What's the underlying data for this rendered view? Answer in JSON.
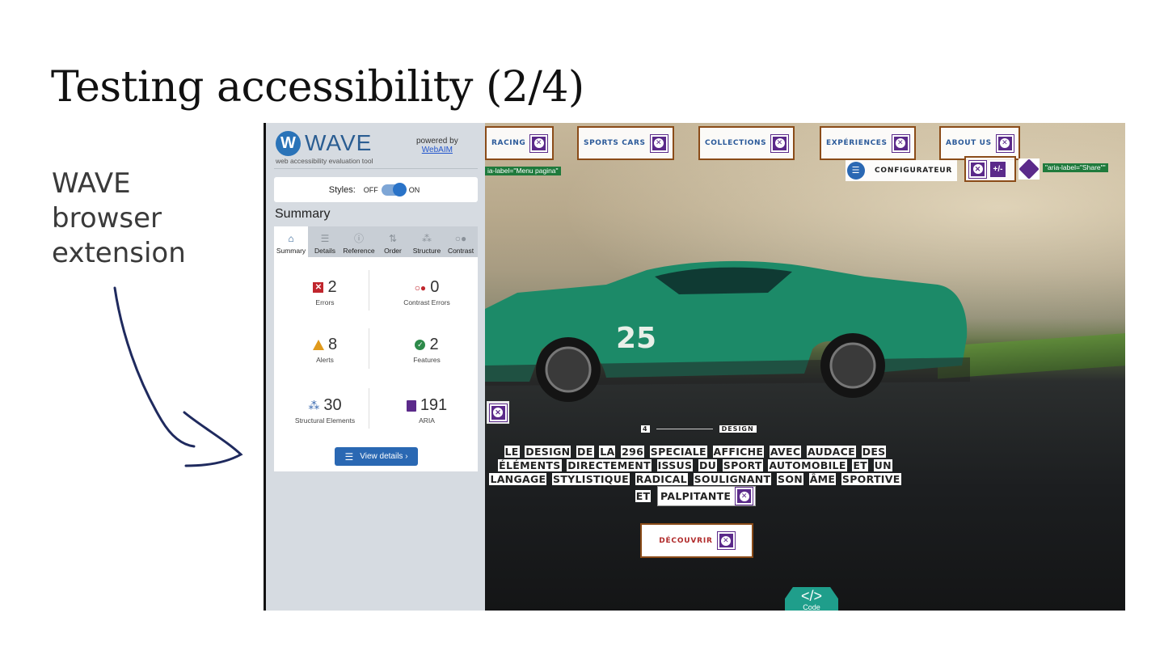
{
  "slide": {
    "title": "Testing accessibility (2/4)",
    "side_label": "WAVE browser extension"
  },
  "wave": {
    "logo_text": "WAVE",
    "tagline": "web accessibility evaluation tool",
    "powered_by": "powered by",
    "webaim": "WebAIM",
    "styles_label": "Styles:",
    "off": "OFF",
    "on": "ON",
    "summary_heading": "Summary",
    "tabs": [
      {
        "label": "Summary",
        "icon": "home-icon",
        "glyph": "⌂"
      },
      {
        "label": "Details",
        "icon": "list-icon",
        "glyph": "☰"
      },
      {
        "label": "Reference",
        "icon": "info-icon",
        "glyph": "ⓘ"
      },
      {
        "label": "Order",
        "icon": "order-icon",
        "glyph": "⇅"
      },
      {
        "label": "Structure",
        "icon": "structure-icon",
        "glyph": "⁂"
      },
      {
        "label": "Contrast",
        "icon": "contrast-icon",
        "glyph": "○●"
      }
    ],
    "stats": {
      "errors": {
        "value": "2",
        "label": "Errors"
      },
      "contrast": {
        "value": "0",
        "label": "Contrast Errors"
      },
      "alerts": {
        "value": "8",
        "label": "Alerts"
      },
      "features": {
        "value": "2",
        "label": "Features"
      },
      "structural": {
        "value": "30",
        "label": "Structural Elements"
      },
      "aria": {
        "value": "191",
        "label": "ARIA"
      }
    },
    "view_details": "View details ›"
  },
  "site": {
    "nav": [
      "RACING",
      "SPORTS CARS",
      "COLLECTIONS",
      "EXPÉRIENCES",
      "ABOUT US"
    ],
    "aria_menu": "ia-label=\"Menu pagina\"",
    "aria_share": "\"aria-label=\"Share\"\"",
    "configurateur": "CONFIGURATEUR",
    "plus_minus": "+/-",
    "car_number": "25",
    "counter_num": "4",
    "counter_label": "DESIGN",
    "headline_words": [
      "LE",
      "DESIGN",
      "DE",
      "LA",
      "296",
      "SPECIALE",
      "AFFICHE",
      "AVEC",
      "AUDACE",
      "DES",
      "ÉLÉMENTS",
      "DIRECTEMENT",
      "ISSUS",
      "DU",
      "SPORT",
      "AUTOMOBILE",
      "ET",
      "UN",
      "LANGAGE",
      "STYLISTIQUE",
      "RADICAL",
      "SOULIGNANT",
      "SON",
      "ÂME",
      "SPORTIVE",
      "ET"
    ],
    "headline_last": "PALPITANTE",
    "cta": "DÉCOUVRIR",
    "code_glyph": "</>",
    "code_label": "Code"
  },
  "colors": {
    "wave_blue": "#2a68b3",
    "wave_purple": "#5b2a8a",
    "error_red": "#c0262d",
    "aria_green": "#1f7a3c",
    "nav_border": "#8a4b18",
    "car_green": "#1f8a6a"
  }
}
